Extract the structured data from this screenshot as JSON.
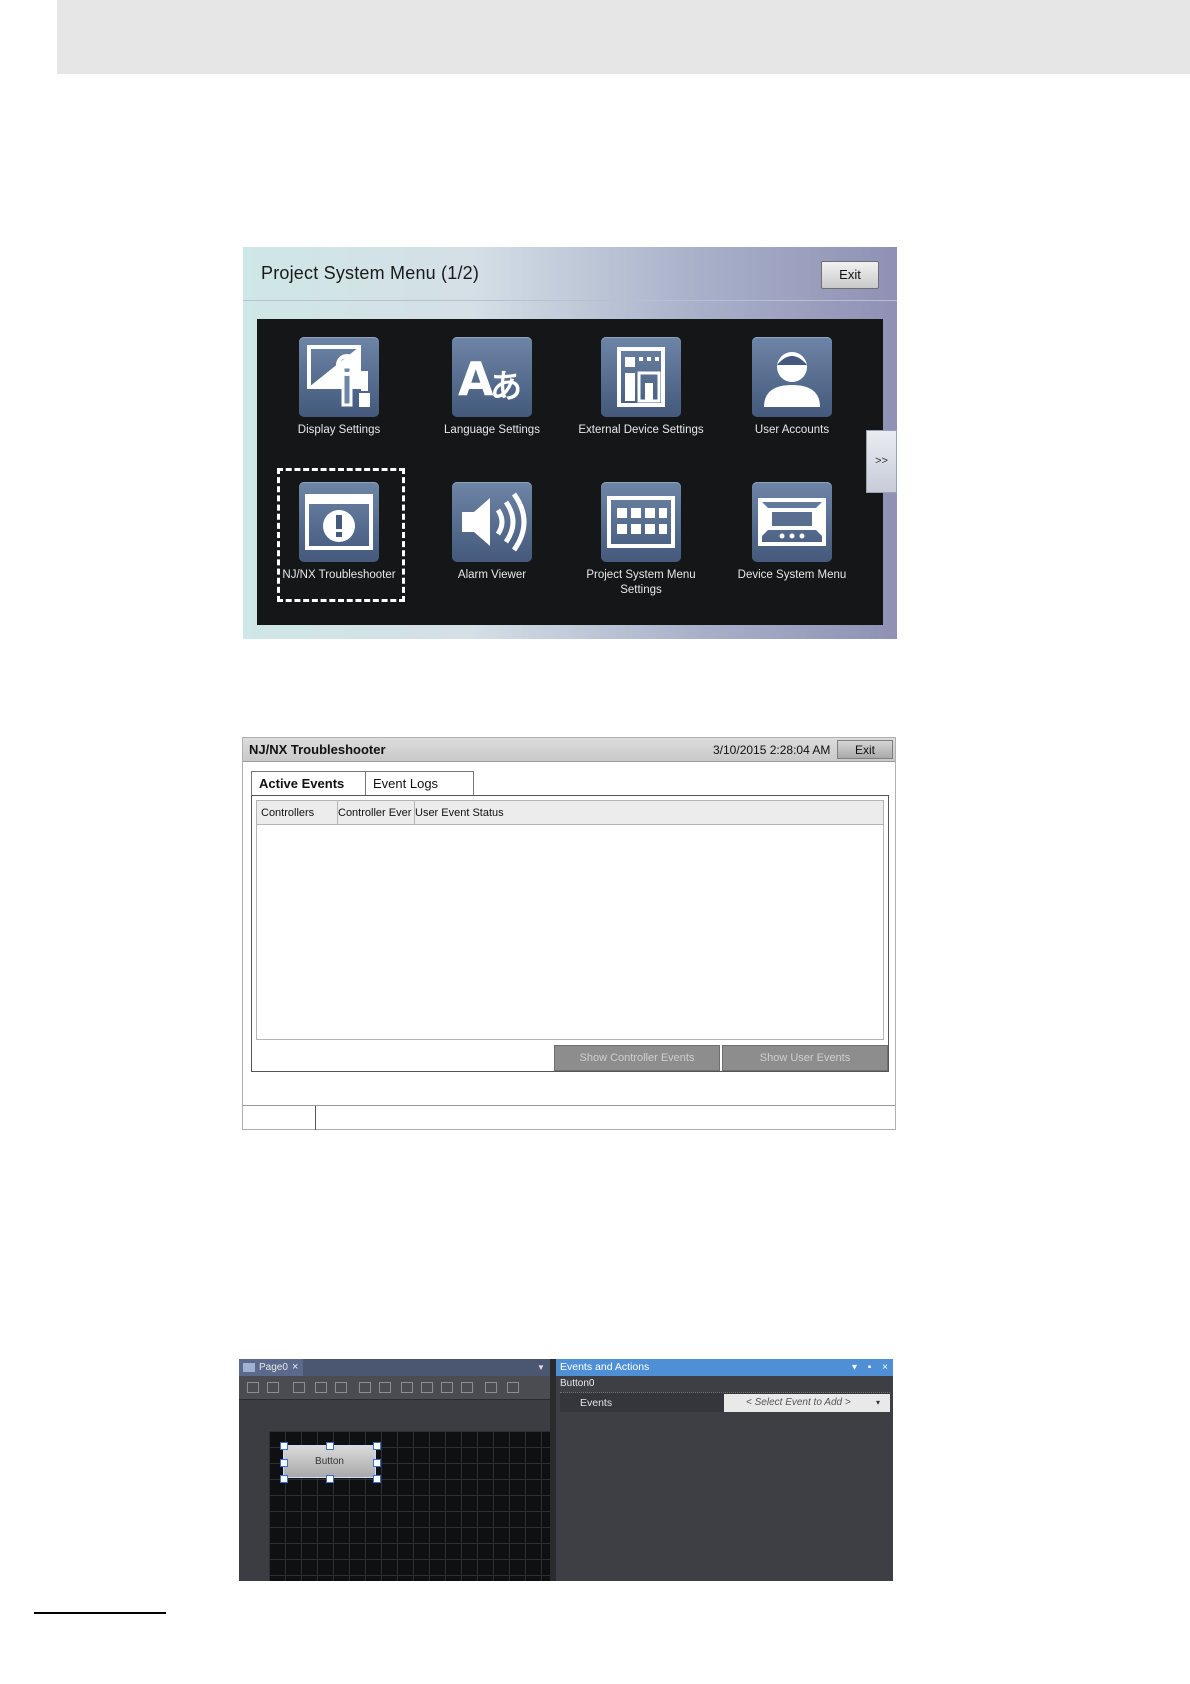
{
  "psm": {
    "title": "Project System Menu (1/2)",
    "exit_label": "Exit",
    "next_label": ">>",
    "tiles": [
      {
        "label": "Display Settings",
        "icon": "display-settings-icon"
      },
      {
        "label": "Language Settings",
        "icon": "language-settings-icon"
      },
      {
        "label": "External Device Settings",
        "icon": "external-device-icon"
      },
      {
        "label": "User Accounts",
        "icon": "user-accounts-icon"
      },
      {
        "label": "NJ/NX Troubleshooter",
        "icon": "troubleshooter-icon"
      },
      {
        "label": "Alarm Viewer",
        "icon": "speaker-icon"
      },
      {
        "label": "Project System Menu Settings",
        "icon": "keypad-icon"
      },
      {
        "label": "Device System Menu",
        "icon": "device-menu-icon"
      }
    ]
  },
  "ts": {
    "title": "NJ/NX Troubleshooter",
    "datetime": "3/10/2015 2:28:04 AM",
    "exit_label": "Exit",
    "tabs": [
      "Active Events",
      "Event Logs"
    ],
    "columns": [
      "Controllers",
      "Controller Ever",
      "User Event Status"
    ],
    "buttons": [
      "Show Controller Events",
      "Show User Events"
    ]
  },
  "editor": {
    "tab_label": "Page0",
    "tab_close": "×",
    "button_label": "Button",
    "panel_title": "Events and Actions",
    "panel_controls": "▾ ▪ ×",
    "object_name": "Button0",
    "events_label": "Events",
    "select_placeholder": "< Select Event to Add >",
    "select_arrow": "▾"
  }
}
